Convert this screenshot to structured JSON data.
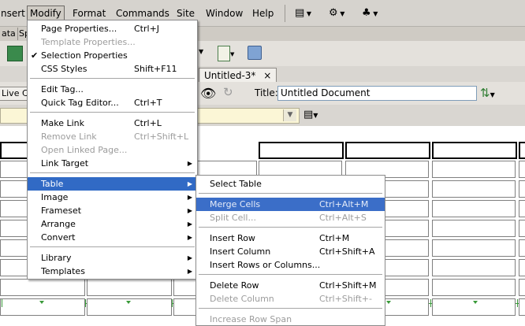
{
  "menubar": {
    "items": [
      "nsert",
      "Modify",
      "Format",
      "Commands",
      "Site",
      "Window",
      "Help"
    ],
    "icons": [
      "layout-icon",
      "gear-icon",
      "site-map-icon"
    ]
  },
  "strip1": {
    "tabs": [
      "ata",
      "Sp"
    ]
  },
  "tabs": {
    "doc_tab": "Untitled-3*",
    "close": "×"
  },
  "doc_toolbar": {
    "live_code": "Live Co",
    "title_label": "Title:",
    "title_value": "Untitled Document"
  },
  "modify_menu": {
    "items": [
      {
        "label": "Page Properties...",
        "shortcut": "Ctrl+J",
        "disabled": false
      },
      {
        "label": "Template Properties...",
        "shortcut": "",
        "disabled": true
      },
      {
        "label": "Selection Properties",
        "shortcut": "",
        "disabled": false,
        "checked": true
      },
      {
        "label": "CSS Styles",
        "shortcut": "Shift+F11",
        "disabled": false
      },
      {
        "label": "Edit Tag...",
        "shortcut": "",
        "disabled": false
      },
      {
        "label": "Quick Tag Editor...",
        "shortcut": "Ctrl+T",
        "disabled": false
      },
      {
        "label": "Make Link",
        "shortcut": "Ctrl+L",
        "disabled": false
      },
      {
        "label": "Remove Link",
        "shortcut": "Ctrl+Shift+L",
        "disabled": true
      },
      {
        "label": "Open Linked Page...",
        "shortcut": "",
        "disabled": true
      },
      {
        "label": "Link Target",
        "shortcut": "",
        "disabled": false,
        "submenu": true
      },
      {
        "label": "Table",
        "shortcut": "",
        "disabled": false,
        "submenu": true,
        "highlighted": true
      },
      {
        "label": "Image",
        "shortcut": "",
        "disabled": false,
        "submenu": true
      },
      {
        "label": "Frameset",
        "shortcut": "",
        "disabled": false,
        "submenu": true
      },
      {
        "label": "Arrange",
        "shortcut": "",
        "disabled": false,
        "submenu": true
      },
      {
        "label": "Convert",
        "shortcut": "",
        "disabled": false,
        "submenu": true
      },
      {
        "label": "Library",
        "shortcut": "",
        "disabled": false,
        "submenu": true
      },
      {
        "label": "Templates",
        "shortcut": "",
        "disabled": false,
        "submenu": true
      }
    ]
  },
  "table_menu": {
    "items": [
      {
        "label": "Select Table",
        "shortcut": "",
        "disabled": false
      },
      {
        "label": "Merge Cells",
        "shortcut": "Ctrl+Alt+M",
        "disabled": false,
        "highlighted": true
      },
      {
        "label": "Split Cell...",
        "shortcut": "Ctrl+Alt+S",
        "disabled": true
      },
      {
        "label": "Insert Row",
        "shortcut": "Ctrl+M",
        "disabled": false
      },
      {
        "label": "Insert Column",
        "shortcut": "Ctrl+Shift+A",
        "disabled": false
      },
      {
        "label": "Insert Rows or Columns...",
        "shortcut": "",
        "disabled": false
      },
      {
        "label": "Delete Row",
        "shortcut": "Ctrl+Shift+M",
        "disabled": false
      },
      {
        "label": "Delete Column",
        "shortcut": "Ctrl+Shift+-",
        "disabled": true
      },
      {
        "label": "Increase Row Span",
        "shortcut": "",
        "disabled": true
      }
    ]
  },
  "colors": {
    "highlight": "#316ac5",
    "menubar": "#d6d3ce"
  }
}
